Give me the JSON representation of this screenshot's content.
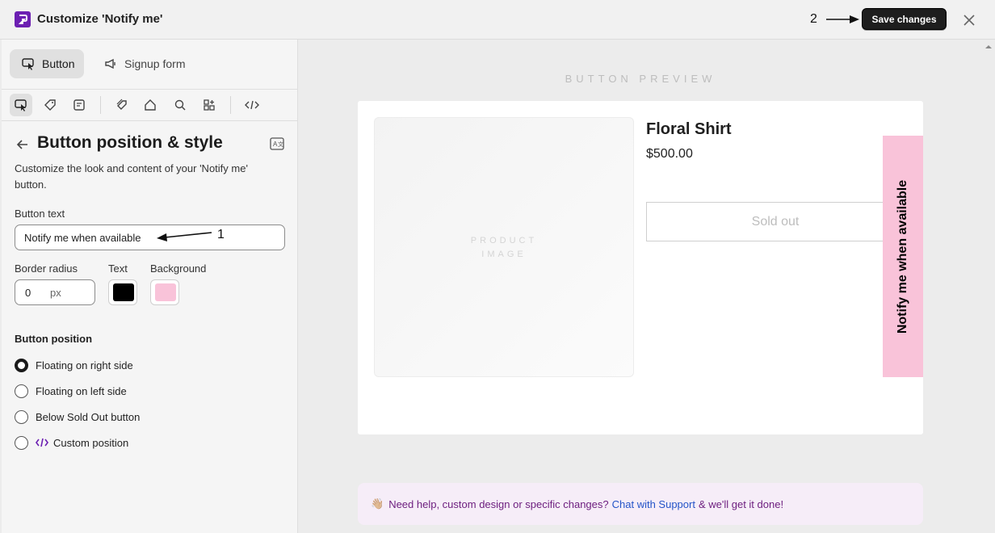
{
  "header": {
    "title": "Customize 'Notify me'",
    "annotation_2": "2",
    "save_label": "Save changes"
  },
  "tabs": [
    {
      "label": "Button",
      "active": true
    },
    {
      "label": "Signup form",
      "active": false
    }
  ],
  "panel": {
    "heading": "Button position & style",
    "description": "Customize the look and content of your 'Notify me' button.",
    "button_text_label": "Button text",
    "button_text_value": "Notify me when available",
    "annotation_1": "1",
    "border_radius_label": "Border radius",
    "border_radius_value": "0",
    "border_radius_unit": "px",
    "text_color_label": "Text",
    "background_label": "Background",
    "text_color": "#000000",
    "background_color": "#f9c3d9",
    "position_title": "Button position",
    "positions": [
      {
        "label": "Floating on right side",
        "checked": true
      },
      {
        "label": "Floating on left side",
        "checked": false
      },
      {
        "label": "Below Sold Out button",
        "checked": false
      },
      {
        "label": "Custom position",
        "checked": false
      }
    ]
  },
  "preview": {
    "label": "BUTTON PREVIEW",
    "image_text_1": "PRODUCT",
    "image_text_2": "IMAGE",
    "product_title": "Floral Shirt",
    "product_price": "$500.00",
    "soldout_label": "Sold out",
    "notify_label": "Notify me when available"
  },
  "help": {
    "emoji": "👋🏼",
    "text_before": "Need help, custom design or specific changes?",
    "link": "Chat with Support",
    "text_after": "& we'll get it done!"
  },
  "colors": {
    "brand": "#6c1fb2",
    "accent_pink": "#f9c3d9",
    "help_bg": "#f6edf8"
  }
}
